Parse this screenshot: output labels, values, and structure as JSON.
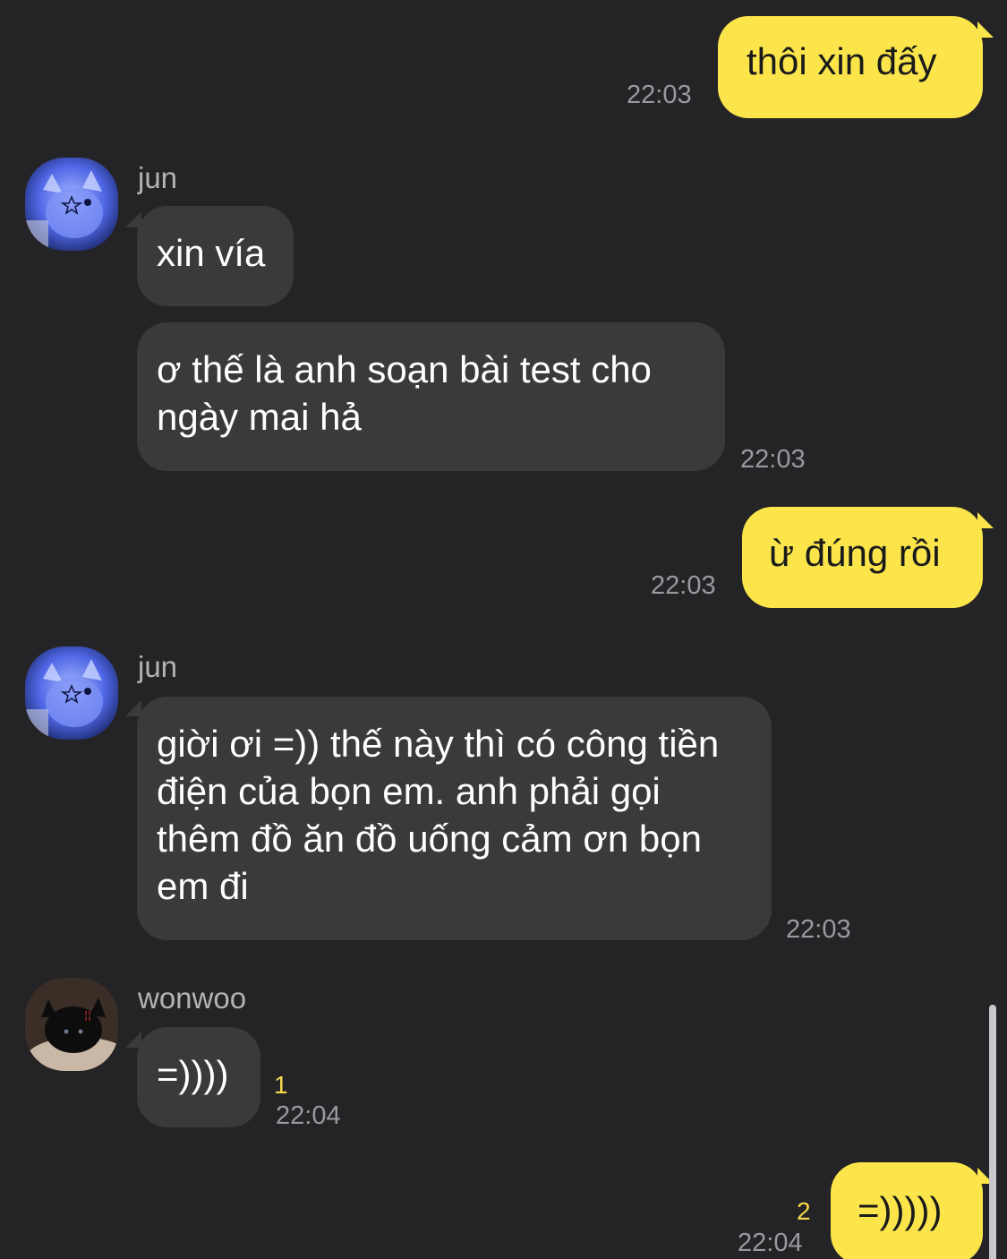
{
  "messages": [
    {
      "id": "m1",
      "from": "me",
      "text": "thôi xin đấy",
      "time": "22:03"
    },
    {
      "id": "m2",
      "from": "jun",
      "sender_name": "jun",
      "text": "xin vía"
    },
    {
      "id": "m3",
      "from": "jun",
      "text": "ơ thế là anh soạn bài test cho ngày mai hả",
      "time": "22:03"
    },
    {
      "id": "m4",
      "from": "me",
      "text": "ừ đúng rồi",
      "time": "22:03"
    },
    {
      "id": "m5",
      "from": "jun",
      "sender_name": "jun",
      "text": "giời ơi =)) thế này thì có công tiền điện của bọn em. anh phải gọi thêm đồ ăn đồ uống cảm ơn bọn em đi",
      "time": "22:03"
    },
    {
      "id": "m6",
      "from": "wonwoo",
      "sender_name": "wonwoo",
      "text": "=))))",
      "time": "22:04",
      "unread": "1"
    },
    {
      "id": "m7",
      "from": "me",
      "text": "=)))))",
      "time": "22:04",
      "unread": "2"
    }
  ],
  "avatars": {
    "jun": "blue-cat-avatar",
    "wonwoo": "black-cat-avatar"
  },
  "colors": {
    "background": "#242426",
    "my_bubble": "#fbe54b",
    "their_bubble": "#3a3a3c",
    "unread_count": "#f5d94b"
  }
}
